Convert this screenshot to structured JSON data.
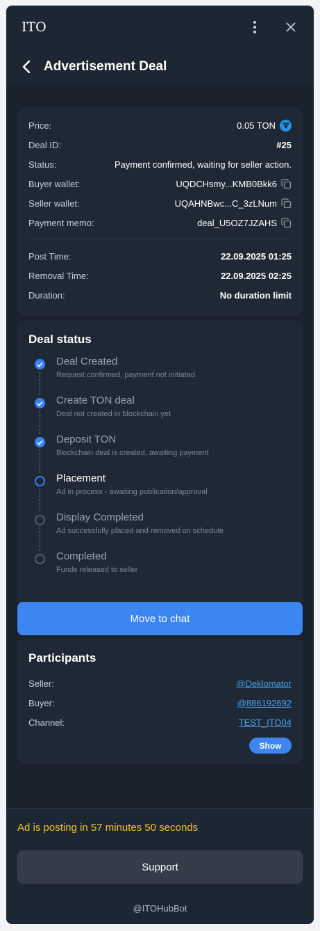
{
  "window": {
    "app_title": "ITO"
  },
  "header": {
    "title": "Advertisement Deal"
  },
  "deal": {
    "rows": [
      {
        "label": "Price:",
        "value": "0.05 TON"
      },
      {
        "label": "Deal ID:",
        "value": "#25"
      },
      {
        "label": "Status:",
        "value": "Payment confirmed, waiting for seller action."
      },
      {
        "label": "Buyer wallet:",
        "value": "UQDCHsmy...KMB0Bkk6"
      },
      {
        "label": "Seller wallet:",
        "value": "UQAHNBwc...C_3zLNum"
      },
      {
        "label": "Payment memo:",
        "value": "deal_U5OZ7JZAHS"
      }
    ],
    "times": [
      {
        "label": "Post Time:",
        "value": "22.09.2025 01:25"
      },
      {
        "label": "Removal Time:",
        "value": "22.09.2025 02:25"
      },
      {
        "label": "Duration:",
        "value": "No duration limit"
      }
    ]
  },
  "deal_status": {
    "title": "Deal status",
    "steps": [
      {
        "title": "Deal Created",
        "subtitle": "Request confirmed, payment not initiated",
        "state": "done"
      },
      {
        "title": "Create TON deal",
        "subtitle": "Deal not created in blockchain yet",
        "state": "done"
      },
      {
        "title": "Deposit TON",
        "subtitle": "Blockchain deal is created, awaiting payment",
        "state": "done"
      },
      {
        "title": "Placement",
        "subtitle": "Ad in process - awaiting publication/approval",
        "state": "current"
      },
      {
        "title": "Display Completed",
        "subtitle": "Ad successfully placed and removed on schedule",
        "state": "pending"
      },
      {
        "title": "Completed",
        "subtitle": "Funds released to seller",
        "state": "pending"
      }
    ]
  },
  "actions": {
    "move_to_chat": "Move to chat",
    "support": "Support"
  },
  "participants": {
    "title": "Participants",
    "rows": [
      {
        "label": "Seller:",
        "value": "@Deklomator"
      },
      {
        "label": "Buyer:",
        "value": "@886192692"
      },
      {
        "label": "Channel:",
        "value": "TEST_ITO04"
      }
    ],
    "show_label": "Show"
  },
  "countdown": "Ad is posting in 57 minutes 50 seconds",
  "footer": "@ITOHubBot",
  "colors": {
    "accent": "#3d85f0",
    "warning": "#f2c12e",
    "link": "#4aa0ee"
  }
}
